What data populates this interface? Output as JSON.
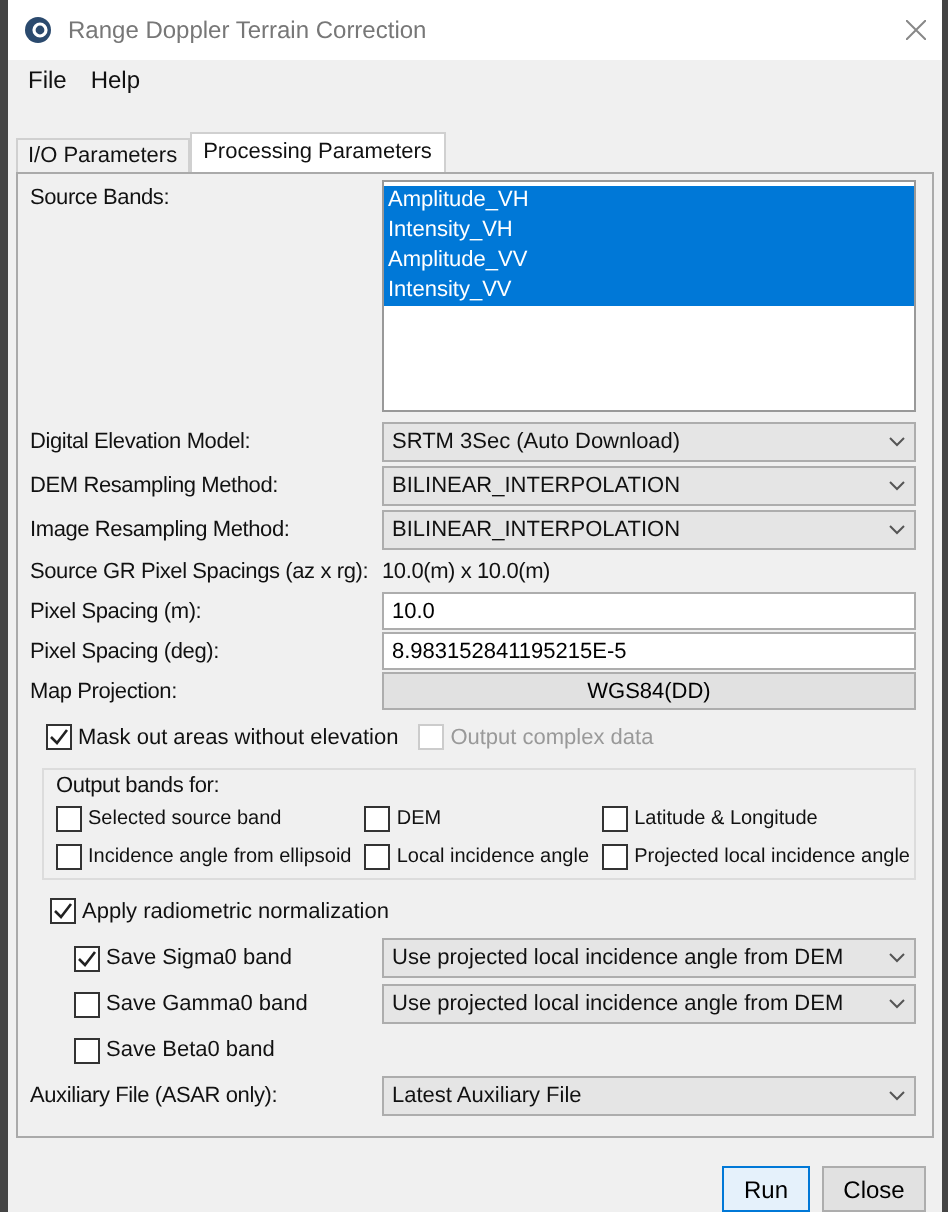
{
  "window": {
    "title": "Range Doppler Terrain Correction"
  },
  "menu": [
    "File",
    "Help"
  ],
  "tabs": [
    {
      "label": "I/O Parameters",
      "selected": false
    },
    {
      "label": "Processing Parameters",
      "selected": true
    }
  ],
  "source_bands": {
    "label": "Source Bands:",
    "items": [
      {
        "label": "Amplitude_VH",
        "selected": true
      },
      {
        "label": "Intensity_VH",
        "selected": true
      },
      {
        "label": "Amplitude_VV",
        "selected": true
      },
      {
        "label": "Intensity_VV",
        "selected": true
      }
    ]
  },
  "parameters": [
    {
      "kind": "select",
      "label": "Digital Elevation Model:",
      "value": "SRTM 3Sec (Auto Download)"
    },
    {
      "kind": "select",
      "label": "DEM Resampling Method:",
      "value": "BILINEAR_INTERPOLATION"
    },
    {
      "kind": "select",
      "label": "Image Resampling Method:",
      "value": "BILINEAR_INTERPOLATION"
    },
    {
      "kind": "readout",
      "label": "Source GR Pixel Spacings (az x rg):",
      "value": "10.0(m) x 10.0(m)"
    },
    {
      "kind": "input",
      "label": "Pixel Spacing (m):",
      "value": "10.0"
    },
    {
      "kind": "input",
      "label": "Pixel Spacing (deg):",
      "value": "8.983152841195215E-5"
    },
    {
      "kind": "button",
      "label": "Map Projection:",
      "value": "WGS84(DD)"
    }
  ],
  "options": [
    {
      "label": "Mask out areas without elevation",
      "checked": true,
      "disabled": false
    },
    {
      "label": "Output complex data",
      "checked": false,
      "disabled": true
    }
  ],
  "output_bands": {
    "label": "Output bands for:",
    "items": [
      {
        "label": "Selected source band",
        "checked": false
      },
      {
        "label": "DEM",
        "checked": false
      },
      {
        "label": "Latitude & Longitude",
        "checked": false
      },
      {
        "label": "Incidence angle from ellipsoid",
        "checked": false
      },
      {
        "label": "Local incidence angle",
        "checked": false
      },
      {
        "label": "Projected local incidence angle",
        "checked": false
      }
    ]
  },
  "radiometric": {
    "label": "Apply radiometric normalization",
    "checked": true,
    "bands": [
      {
        "label": "Save Sigma0 band",
        "checked": true,
        "method": "Use projected local incidence angle from DEM"
      },
      {
        "label": "Save Gamma0 band",
        "checked": false,
        "method": "Use projected local incidence angle from DEM"
      },
      {
        "label": "Save Beta0 band",
        "checked": false
      }
    ]
  },
  "auxiliary": {
    "label": "Auxiliary File (ASAR only):",
    "value": "Latest Auxiliary File"
  },
  "buttons": [
    {
      "label": "Run",
      "focused": true
    },
    {
      "label": "Close",
      "focused": false
    }
  ]
}
